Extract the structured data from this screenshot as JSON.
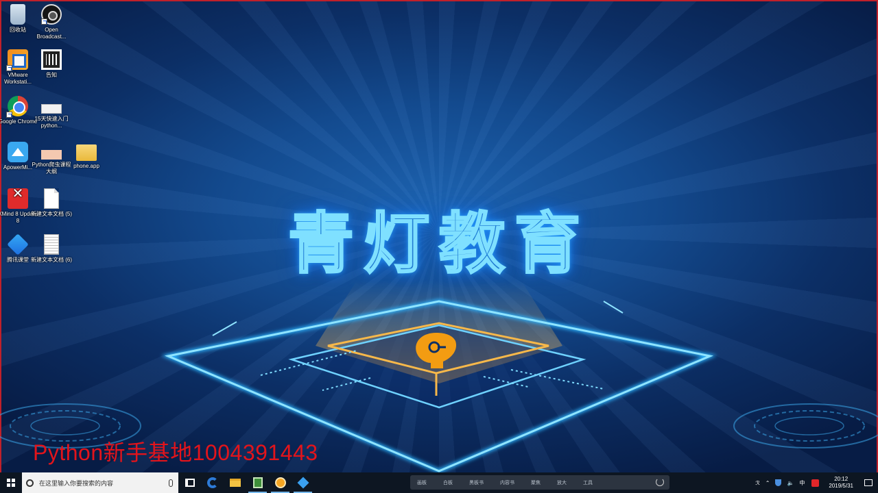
{
  "desktop": {
    "icons": [
      {
        "label": "回收站",
        "icon": "recycle-bin-icon"
      },
      {
        "label": "Open Broadcast...",
        "icon": "obs-icon"
      },
      {
        "label": "VMware Workstati...",
        "icon": "vmware-icon"
      },
      {
        "label": "告知",
        "icon": "qr-code-icon"
      },
      {
        "label": "Google Chrome",
        "icon": "chrome-icon"
      },
      {
        "label": "15天快速入门python...",
        "icon": "image-file-icon"
      },
      {
        "label": "ApowerMi...",
        "icon": "apowermirror-icon"
      },
      {
        "label": "Python爬虫课程大纲",
        "icon": "image-file-icon"
      },
      {
        "label": "phone.app",
        "icon": "folder-icon"
      },
      {
        "label": "XMind 8 Update 8",
        "icon": "xmind-icon"
      },
      {
        "label": "新建文本文档 (5)",
        "icon": "text-file-icon"
      },
      {
        "label": "腾讯课堂",
        "icon": "tencent-classroom-icon"
      },
      {
        "label": "新建文本文档 (6)",
        "icon": "text-file-icon"
      }
    ]
  },
  "wallpaper": {
    "brand_text": "青灯教育",
    "accent_color": "#7fe0ff",
    "logo_color": "#f39c12"
  },
  "watermark": {
    "text": "Python新手基地1004391443",
    "color": "#e3141b"
  },
  "taskbar": {
    "search_placeholder": "在这里输入你要搜索的内容",
    "toolbar_items": [
      "画板",
      "白板",
      "黑板书",
      "内容书",
      "聚焦",
      "放大",
      "工具"
    ],
    "tray": {
      "network": "ℛ",
      "ime": "中",
      "time": "20:12",
      "date": "2019/5/31"
    }
  }
}
